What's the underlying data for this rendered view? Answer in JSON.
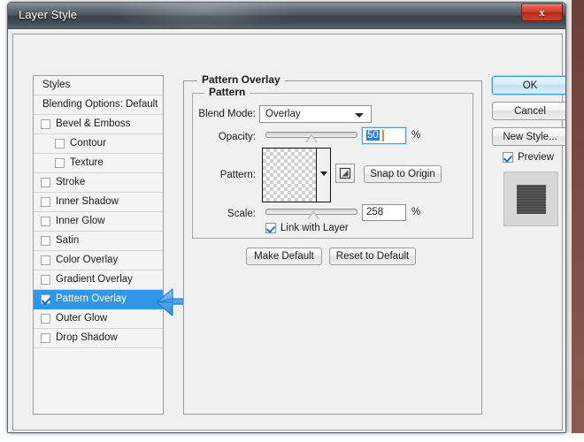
{
  "window": {
    "title": "Layer Style",
    "close_label": "x"
  },
  "styles_panel": {
    "items": [
      {
        "label": "Styles",
        "type": "header",
        "indent": false,
        "checked": false,
        "selected": false
      },
      {
        "label": "Blending Options: Default",
        "type": "header",
        "indent": false,
        "checked": false,
        "selected": false
      },
      {
        "label": "Bevel & Emboss",
        "type": "check",
        "indent": false,
        "checked": false,
        "selected": false
      },
      {
        "label": "Contour",
        "type": "check",
        "indent": true,
        "checked": false,
        "selected": false
      },
      {
        "label": "Texture",
        "type": "check",
        "indent": true,
        "checked": false,
        "selected": false
      },
      {
        "label": "Stroke",
        "type": "check",
        "indent": false,
        "checked": false,
        "selected": false
      },
      {
        "label": "Inner Shadow",
        "type": "check",
        "indent": false,
        "checked": false,
        "selected": false
      },
      {
        "label": "Inner Glow",
        "type": "check",
        "indent": false,
        "checked": false,
        "selected": false
      },
      {
        "label": "Satin",
        "type": "check",
        "indent": false,
        "checked": false,
        "selected": false
      },
      {
        "label": "Color Overlay",
        "type": "check",
        "indent": false,
        "checked": false,
        "selected": false
      },
      {
        "label": "Gradient Overlay",
        "type": "check",
        "indent": false,
        "checked": false,
        "selected": false
      },
      {
        "label": "Pattern Overlay",
        "type": "check",
        "indent": false,
        "checked": true,
        "selected": true
      },
      {
        "label": "Outer Glow",
        "type": "check",
        "indent": false,
        "checked": false,
        "selected": false
      },
      {
        "label": "Drop Shadow",
        "type": "check",
        "indent": false,
        "checked": false,
        "selected": false
      }
    ]
  },
  "panel": {
    "outer_group_title": "Pattern Overlay",
    "inner_group_title": "Pattern",
    "blend_mode": {
      "label": "Blend Mode:",
      "value": "Overlay"
    },
    "opacity": {
      "label": "Opacity:",
      "value": "50",
      "unit": "%",
      "slider_percent": 50
    },
    "pattern": {
      "label": "Pattern:",
      "snap_to_origin_label": "Snap to Origin",
      "new_pattern_icon": "new-pattern-icon"
    },
    "scale": {
      "label": "Scale:",
      "value": "258",
      "unit": "%",
      "slider_percent": 52
    },
    "link_with_layer": {
      "label": "Link with Layer",
      "checked": true
    },
    "make_default_label": "Make Default",
    "reset_to_default_label": "Reset to Default"
  },
  "actions": {
    "ok_label": "OK",
    "cancel_label": "Cancel",
    "new_style_label": "New Style...",
    "preview_label": "Preview",
    "preview_checked": true
  },
  "colors": {
    "selection_blue": "#2f96e8",
    "default_button_border": "#3c9bdc",
    "close_red": "#c9452f",
    "annotation_arrow": "#3fa2ef",
    "dialog_face": "#f0f0f0"
  }
}
